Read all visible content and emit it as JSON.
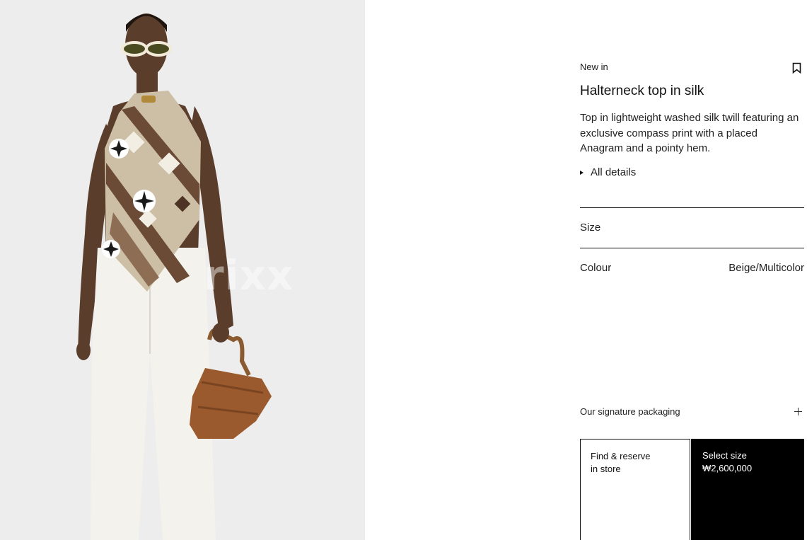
{
  "product": {
    "badge": "New in",
    "title": "Halterneck top in silk",
    "description": "Top in lightweight washed silk twill featuring an exclusive compass print with a placed Anagram and a pointy hem.",
    "details_label": "All details"
  },
  "size": {
    "label": "Size"
  },
  "colour": {
    "label": "Colour",
    "value": "Beige/Multicolor"
  },
  "packaging": {
    "label": "Our signature packaging"
  },
  "actions": {
    "store_line1": "Find & reserve",
    "store_line2": "in store",
    "buy_line1": "Select size",
    "price": "₩2,600,000"
  },
  "watermark": "rixx",
  "colors": {
    "photo_bg": "#ececec",
    "top_beige": "#cdbfa6",
    "top_brown": "#6b4a36",
    "trousers": "#f4f2ec",
    "bag": "#9a5a2e",
    "cta_bg": "#000000"
  },
  "icons": {
    "save": "bookmark-icon",
    "expand": "plus-icon",
    "details": "triangle-right-icon"
  }
}
